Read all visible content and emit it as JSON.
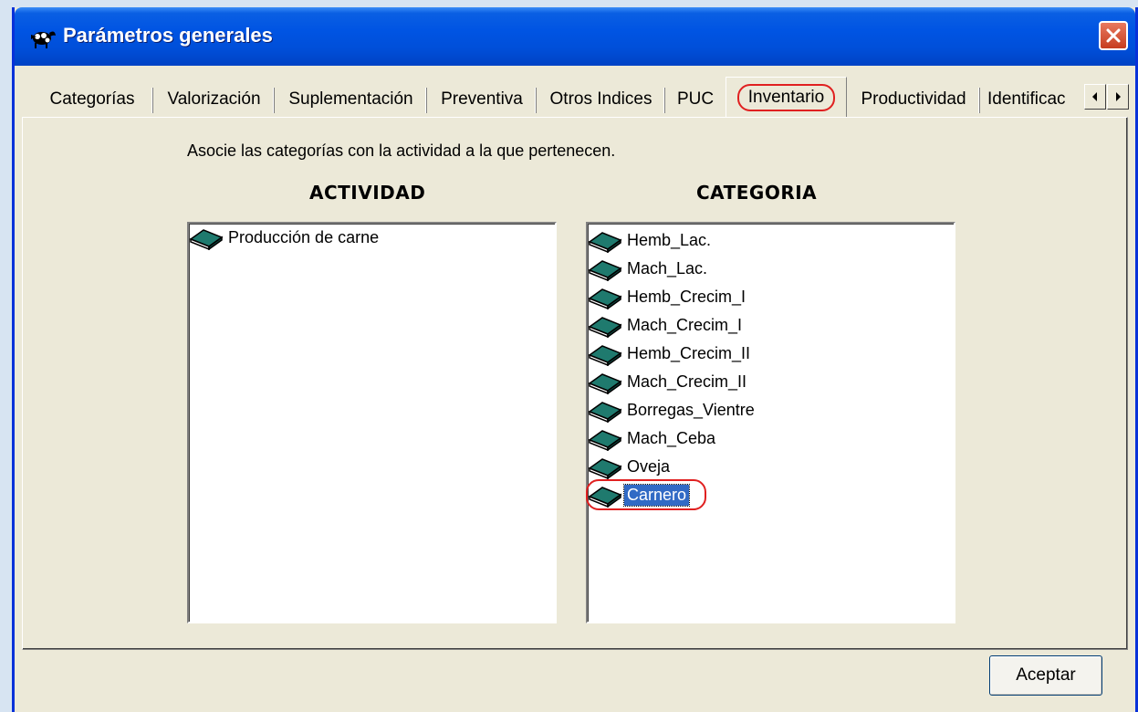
{
  "window": {
    "title": "Parámetros generales"
  },
  "tabs": [
    {
      "label": "Categorías"
    },
    {
      "label": "Valorización"
    },
    {
      "label": "Suplementación"
    },
    {
      "label": "Preventiva"
    },
    {
      "label": "Otros Indices"
    },
    {
      "label": "PUC"
    },
    {
      "label": "Inventario",
      "active": true
    },
    {
      "label": "Productividad"
    },
    {
      "label": "Identificac"
    }
  ],
  "panel": {
    "instruction": "Asocie las categorías con la actividad a la que pertenecen.",
    "actividad_heading": "ACTIVIDAD",
    "categoria_heading": "CATEGORIA",
    "actividades": [
      "Producción de carne"
    ],
    "categorias": [
      "Hemb_Lac.",
      "Mach_Lac.",
      "Hemb_Crecim_I",
      "Mach_Crecim_I",
      "Hemb_Crecim_II",
      "Mach_Crecim_II",
      "Borregas_Vientre",
      "Mach_Ceba",
      "Oveja",
      "Carnero"
    ],
    "selected_categoria": "Carnero"
  },
  "buttons": {
    "accept_label": "Aceptar"
  },
  "icons": {
    "app": "ram-icon",
    "close": "close-icon",
    "list_item": "book-icon",
    "scroll_left": "arrow-left-icon",
    "scroll_right": "arrow-right-icon"
  },
  "colors": {
    "titlebar": "#0054e3",
    "dialog_bg": "#ece9d8",
    "selection": "#316ac5",
    "annotation": "#e02020",
    "book_icon": "#1f7a6e"
  }
}
